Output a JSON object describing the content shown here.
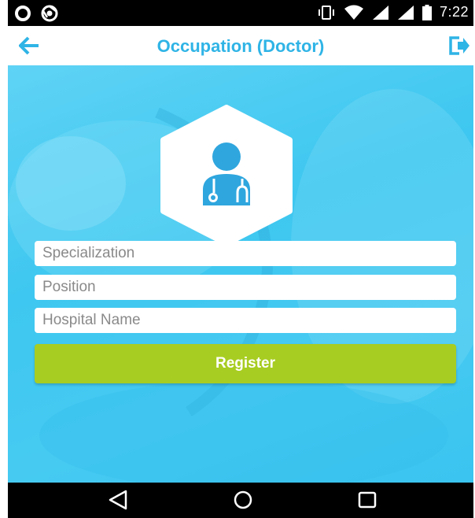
{
  "status_bar": {
    "time": "7:22",
    "icons": [
      "notification-ring-icon",
      "chrome-icon",
      "vibrate-icon",
      "wifi-icon",
      "signal-icon",
      "signal-icon-2",
      "battery-icon"
    ]
  },
  "app_bar": {
    "title": "Occupation (Doctor)",
    "back_icon": "arrow-left-icon",
    "logout_icon": "logout-icon",
    "accent_color": "#2fb4e6"
  },
  "form": {
    "badge_icon": "doctor-icon",
    "fields": [
      {
        "placeholder": "Specialization",
        "value": ""
      },
      {
        "placeholder": "Position",
        "value": ""
      },
      {
        "placeholder": "Hospital Name",
        "value": ""
      }
    ],
    "register_label": "Register",
    "register_color": "#a8cd22",
    "background_color": "#46caf2"
  },
  "nav_bar": {
    "icons": [
      "back-triangle-icon",
      "home-circle-icon",
      "recents-square-icon"
    ]
  }
}
